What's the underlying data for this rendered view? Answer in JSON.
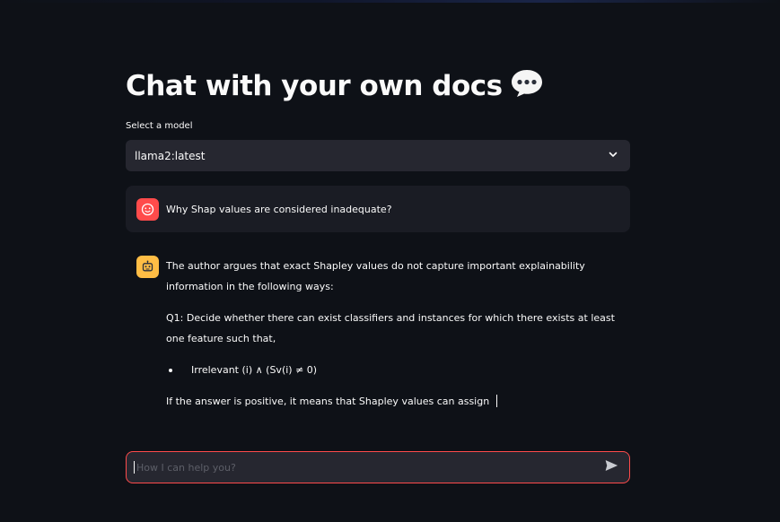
{
  "page": {
    "title": "Chat with your own docs",
    "title_icon": "speech-balloon-icon"
  },
  "model_select": {
    "label": "Select a model",
    "value": "llama2:latest",
    "icon": "chevron-down-icon"
  },
  "messages": [
    {
      "role": "user",
      "avatar_icon": "user-face-icon",
      "avatar_color": "#ff4b4b",
      "text": "Why Shap values are considered inadequate?"
    },
    {
      "role": "assistant",
      "avatar_icon": "robot-icon",
      "avatar_color": "#ffbd45",
      "paragraphs": [
        "The author argues that exact Shapley values do not capture important explainability information in the following ways:",
        "Q1: Decide whether there can exist classifiers and instances for which there exists at least one feature such that,"
      ],
      "bullets": [
        "Irrelevant (i) ∧ (Sv(i) ≠ 0)"
      ],
      "final_text": "If the answer is positive, it means that Shapley values can assign"
    }
  ],
  "chat_input": {
    "placeholder": "How I can help you?",
    "send_icon": "send-arrow-icon"
  },
  "colors": {
    "background": "#0e1117",
    "surface": "#262730",
    "accent": "#ff4b4b",
    "bot_avatar": "#ffbd45"
  }
}
